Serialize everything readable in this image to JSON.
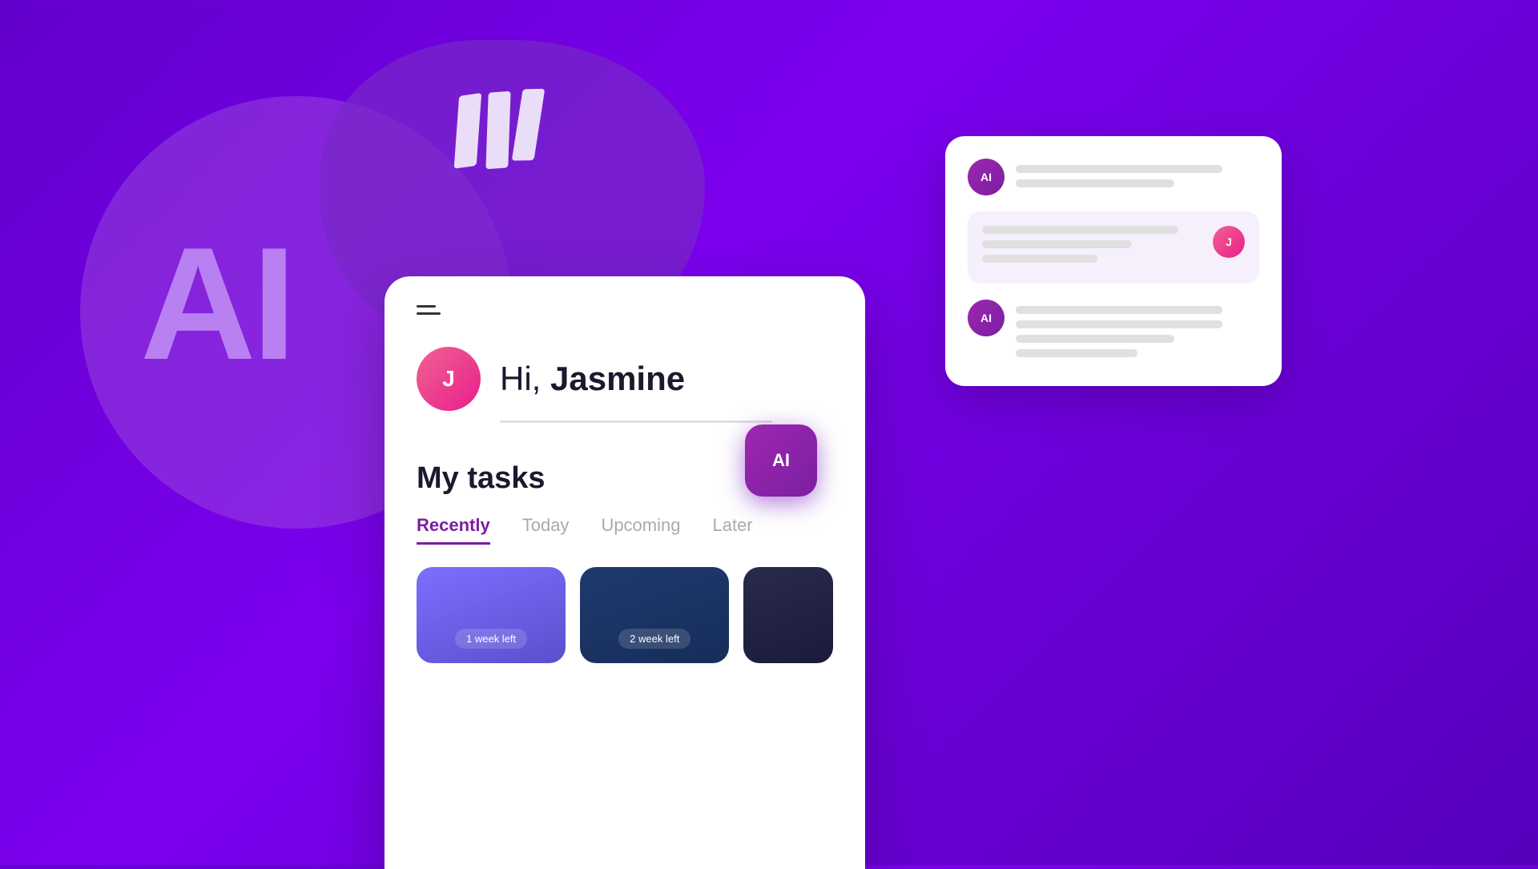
{
  "background": {
    "gradient_start": "#6200cc",
    "gradient_end": "#5500bb"
  },
  "hero": {
    "ai_text": "AI",
    "book_icon_label": "book-stack"
  },
  "chat_card": {
    "avatar_label": "AI",
    "message_lines": [
      "long",
      "medium"
    ],
    "response_lines": [
      "long",
      "medium",
      "short"
    ],
    "user_avatar_label": "J"
  },
  "ai_float_button": {
    "label": "AI"
  },
  "app": {
    "greeting": "Hi, ",
    "name": "Jasmine",
    "tasks_title": "My tasks",
    "tabs": [
      {
        "label": "Recently",
        "active": true
      },
      {
        "label": "Today",
        "active": false
      },
      {
        "label": "Upcoming",
        "active": false
      },
      {
        "label": "Later",
        "active": false
      }
    ],
    "task_cards": [
      {
        "badge": "1 week left",
        "color": "purple"
      },
      {
        "badge": "2 week left",
        "color": "dark-blue"
      },
      {
        "badge": "",
        "color": "very-dark"
      }
    ]
  }
}
